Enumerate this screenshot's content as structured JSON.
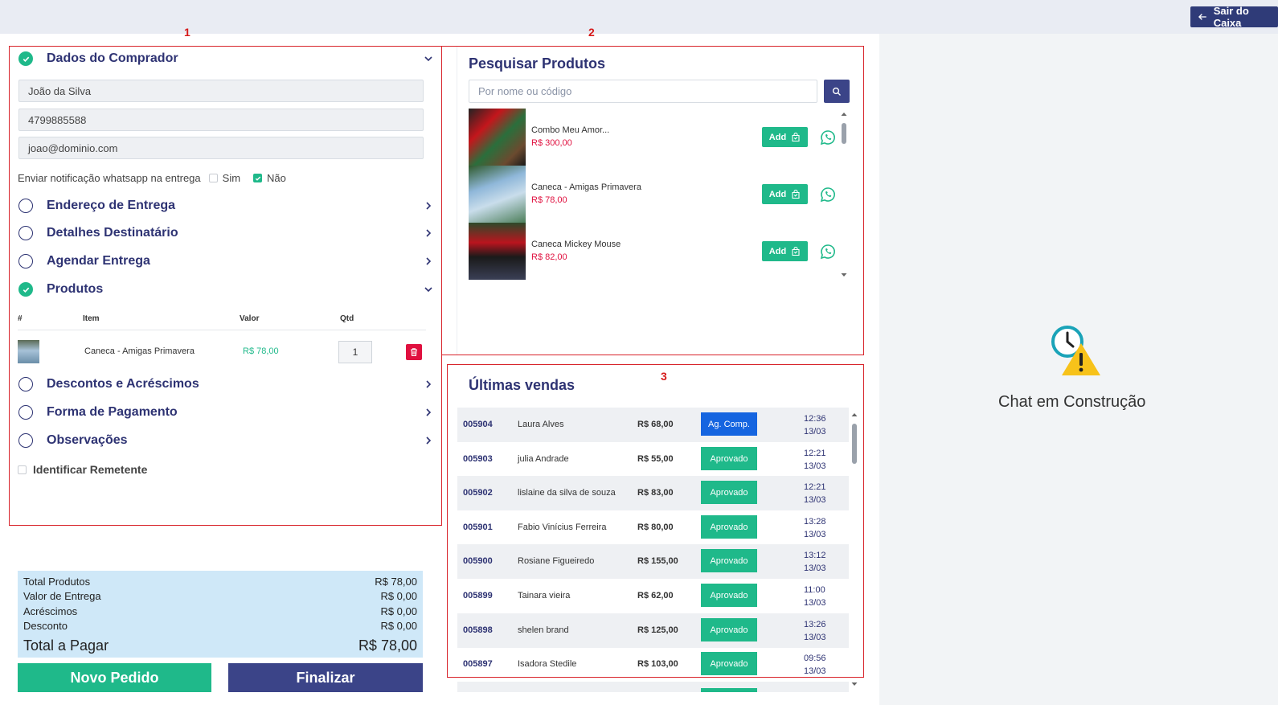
{
  "header": {
    "exit_label": "Sair do Caixa"
  },
  "markers": {
    "m1": "1",
    "m2": "2",
    "m3": "3"
  },
  "buyer": {
    "title": "Dados do Comprador",
    "name": "João da Silva",
    "phone": "4799885588",
    "email": "joao@dominio.com",
    "notify_label": "Enviar notificação whatsapp na entrega",
    "opt_yes": "Sim",
    "opt_no": "Não"
  },
  "sections": {
    "endereco": "Endereço de Entrega",
    "destinatario": "Detalhes Destinatário",
    "agendar": "Agendar Entrega",
    "produtos": "Produtos",
    "descontos": "Descontos e Acréscimos",
    "pagamento": "Forma de Pagamento",
    "observacoes": "Observações",
    "identificar": "Identificar Remetente"
  },
  "cart": {
    "headers": {
      "num": "#",
      "item": "Item",
      "valor": "Valor",
      "qtd": "Qtd"
    },
    "items": [
      {
        "name": "Caneca - Amigas Primavera",
        "value": "R$ 78,00",
        "qty": "1"
      }
    ]
  },
  "totals": {
    "produtos_label": "Total Produtos",
    "produtos": "R$ 78,00",
    "entrega_label": "Valor de Entrega",
    "entrega": "R$ 0,00",
    "acrescimos_label": "Acréscimos",
    "acrescimos": "R$ 0,00",
    "desconto_label": "Desconto",
    "desconto": "R$ 0,00",
    "pagar_label": "Total a Pagar",
    "pagar": "R$ 78,00"
  },
  "actions": {
    "novo": "Novo Pedido",
    "finalizar": "Finalizar"
  },
  "search": {
    "title": "Pesquisar Produtos",
    "placeholder": "Por nome ou código",
    "add_label": "Add",
    "products": [
      {
        "name": "Combo Meu Amor...",
        "price": "R$ 300,00"
      },
      {
        "name": "Caneca - Amigas Primavera",
        "price": "R$ 78,00"
      },
      {
        "name": "Caneca Mickey Mouse",
        "price": "R$ 82,00"
      }
    ]
  },
  "sales": {
    "title": "Últimas vendas",
    "rows": [
      {
        "code": "005904",
        "name": "Laura Alves",
        "amount": "R$ 68,00",
        "status": "Ag. Comp.",
        "time": "12:36",
        "date": "13/03"
      },
      {
        "code": "005903",
        "name": "julia  Andrade",
        "amount": "R$ 55,00",
        "status": "Aprovado",
        "time": "12:21",
        "date": "13/03"
      },
      {
        "code": "005902",
        "name": "lislaine  da silva de souza",
        "amount": "R$ 83,00",
        "status": "Aprovado",
        "time": "12:21",
        "date": "13/03"
      },
      {
        "code": "005901",
        "name": "Fabio  Vinícius Ferreira",
        "amount": "R$ 80,00",
        "status": "Aprovado",
        "time": "13:28",
        "date": "13/03"
      },
      {
        "code": "005900",
        "name": "Rosiane Figueiredo",
        "amount": "R$ 155,00",
        "status": "Aprovado",
        "time": "13:12",
        "date": "13/03"
      },
      {
        "code": "005899",
        "name": "Tainara  vieira",
        "amount": "R$ 62,00",
        "status": "Aprovado",
        "time": "11:00",
        "date": "13/03"
      },
      {
        "code": "005898",
        "name": "shelen brand",
        "amount": "R$ 125,00",
        "status": "Aprovado",
        "time": "13:26",
        "date": "13/03"
      },
      {
        "code": "005897",
        "name": "Isadora  Stedile",
        "amount": "R$ 103,00",
        "status": "Aprovado",
        "time": "09:56",
        "date": "13/03"
      }
    ]
  },
  "chat": {
    "title": "Chat em Construção"
  },
  "colors": {
    "primary": "#3b4488",
    "success": "#1fb98a",
    "danger": "#e0103f",
    "info": "#1565e0",
    "annotation": "#d8232a"
  }
}
